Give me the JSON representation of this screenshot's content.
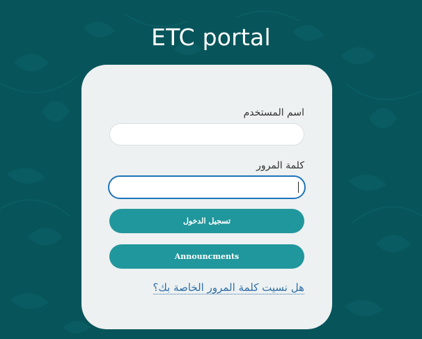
{
  "page": {
    "title": "ETC portal"
  },
  "login_form": {
    "username_label": "اسم المستخدم",
    "username_value": "",
    "password_label": "كلمة المرور",
    "password_value": "",
    "login_button_label": "تسجيل الدخول",
    "announcements_button_label": "Announcments",
    "forgot_password_link": "هل نسيت كلمة المرور الخاصة بك؟"
  },
  "colors": {
    "background": "#07555b",
    "card": "#edf1f1",
    "button": "#20979c",
    "focus_border": "#1d73b8",
    "link": "#2f6fa8"
  }
}
